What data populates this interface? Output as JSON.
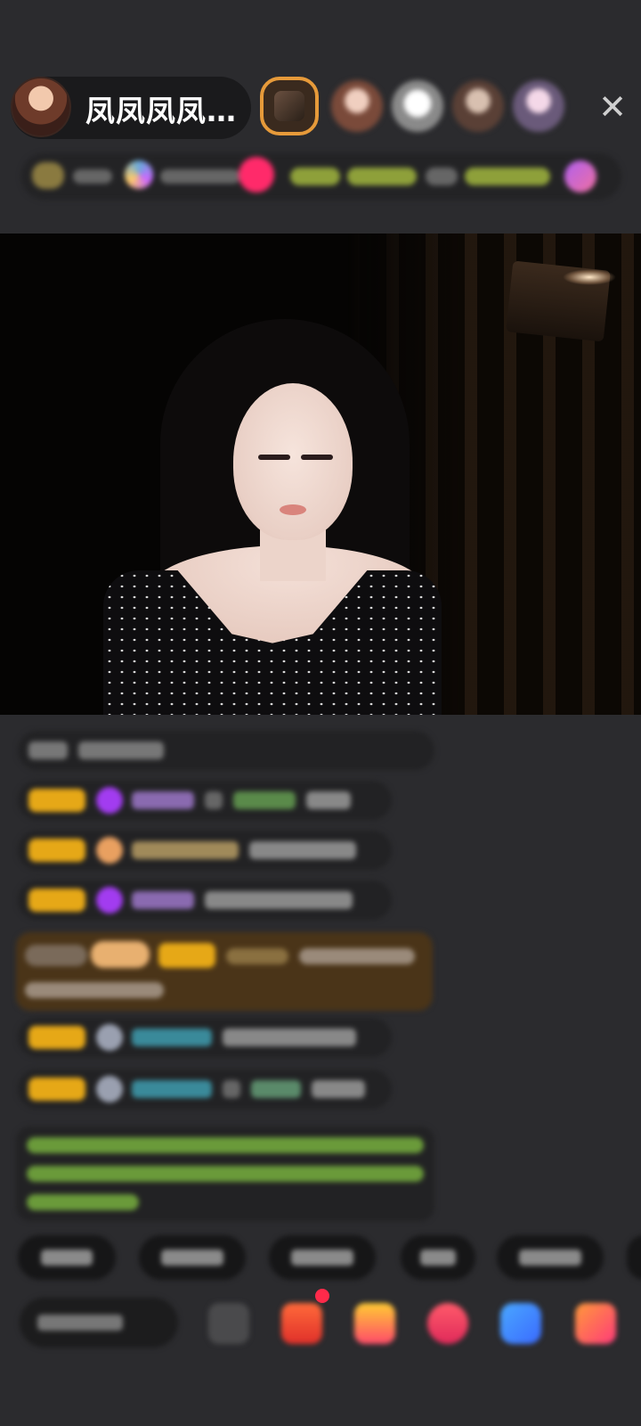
{
  "header": {
    "host_name": "凤凤凤凤…",
    "close_icon": "✕"
  },
  "colors": {
    "background": "#2b2b2e",
    "badge_gold": "#e6a817",
    "gift_message_bg": "#4a3418",
    "notice_text": "#8bc34a",
    "accent_pink": "#ff2a6a"
  }
}
